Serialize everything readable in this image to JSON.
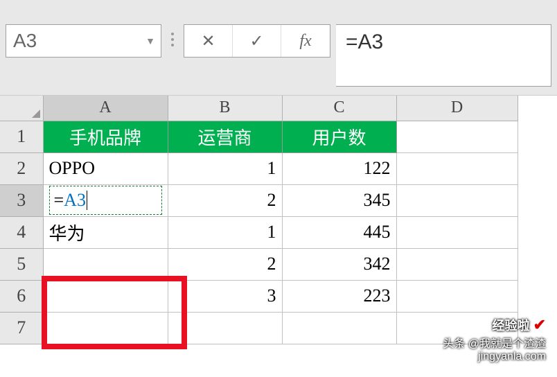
{
  "namebox": {
    "value": "A3"
  },
  "formula_bar": {
    "value": "=A3"
  },
  "formula_controls": {
    "cancel": "✕",
    "confirm": "✓",
    "fx": "fx"
  },
  "columns": [
    "A",
    "B",
    "C",
    "D"
  ],
  "active_column": "A",
  "active_row": "3",
  "headers": {
    "a": "手机品牌",
    "b": "运营商",
    "c": "用户数"
  },
  "rows": [
    {
      "n": "1"
    },
    {
      "n": "2",
      "a": "OPPO",
      "b": "1",
      "c": "122"
    },
    {
      "n": "3",
      "a_eq": "=",
      "a_ref": "A3",
      "b": "2",
      "c": "345"
    },
    {
      "n": "4",
      "a": "华为",
      "b": "1",
      "c": "445"
    },
    {
      "n": "5",
      "a": "",
      "b": "2",
      "c": "342"
    },
    {
      "n": "6",
      "a": "",
      "b": "3",
      "c": "223"
    },
    {
      "n": "7",
      "a": "",
      "b": "",
      "c": ""
    }
  ],
  "watermark": {
    "line1": "经验啦",
    "line2": "头条 @我就是个渣渣",
    "site": "jingyanla.com"
  }
}
